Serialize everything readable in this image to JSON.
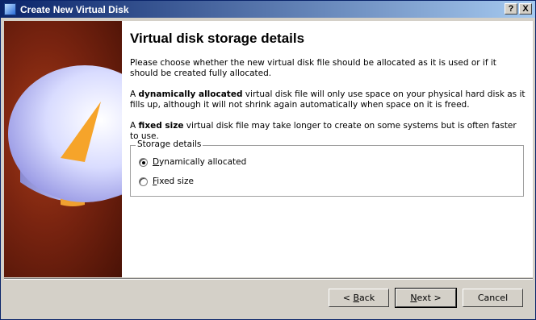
{
  "window": {
    "title": "Create New Virtual Disk"
  },
  "titlebar_buttons": {
    "help": "?",
    "close": "X"
  },
  "page": {
    "heading": "Virtual disk storage details",
    "intro": "Please choose whether the new virtual disk file should be allocated as it is used or if it should be created fully allocated.",
    "dynamic_desc": {
      "pre": "A ",
      "bold": "dynamically allocated",
      "post": " virtual disk file will only use space on your physical hard disk as it fills up, although it will not shrink again automatically when space on it is freed."
    },
    "fixed_desc": {
      "pre": "A ",
      "bold": "fixed size",
      "post": " virtual disk file may take longer to create on some systems but is often faster to use."
    }
  },
  "storage_details": {
    "legend": "Storage details",
    "options": [
      {
        "accel": "D",
        "rest": "ynamically allocated",
        "checked": true
      },
      {
        "accel": "F",
        "rest": "ixed size",
        "checked": false
      }
    ]
  },
  "buttons": {
    "back": {
      "pre": "< ",
      "accel": "B",
      "rest": "ack"
    },
    "next": {
      "accel": "N",
      "rest": "ext >"
    },
    "cancel": "Cancel"
  }
}
